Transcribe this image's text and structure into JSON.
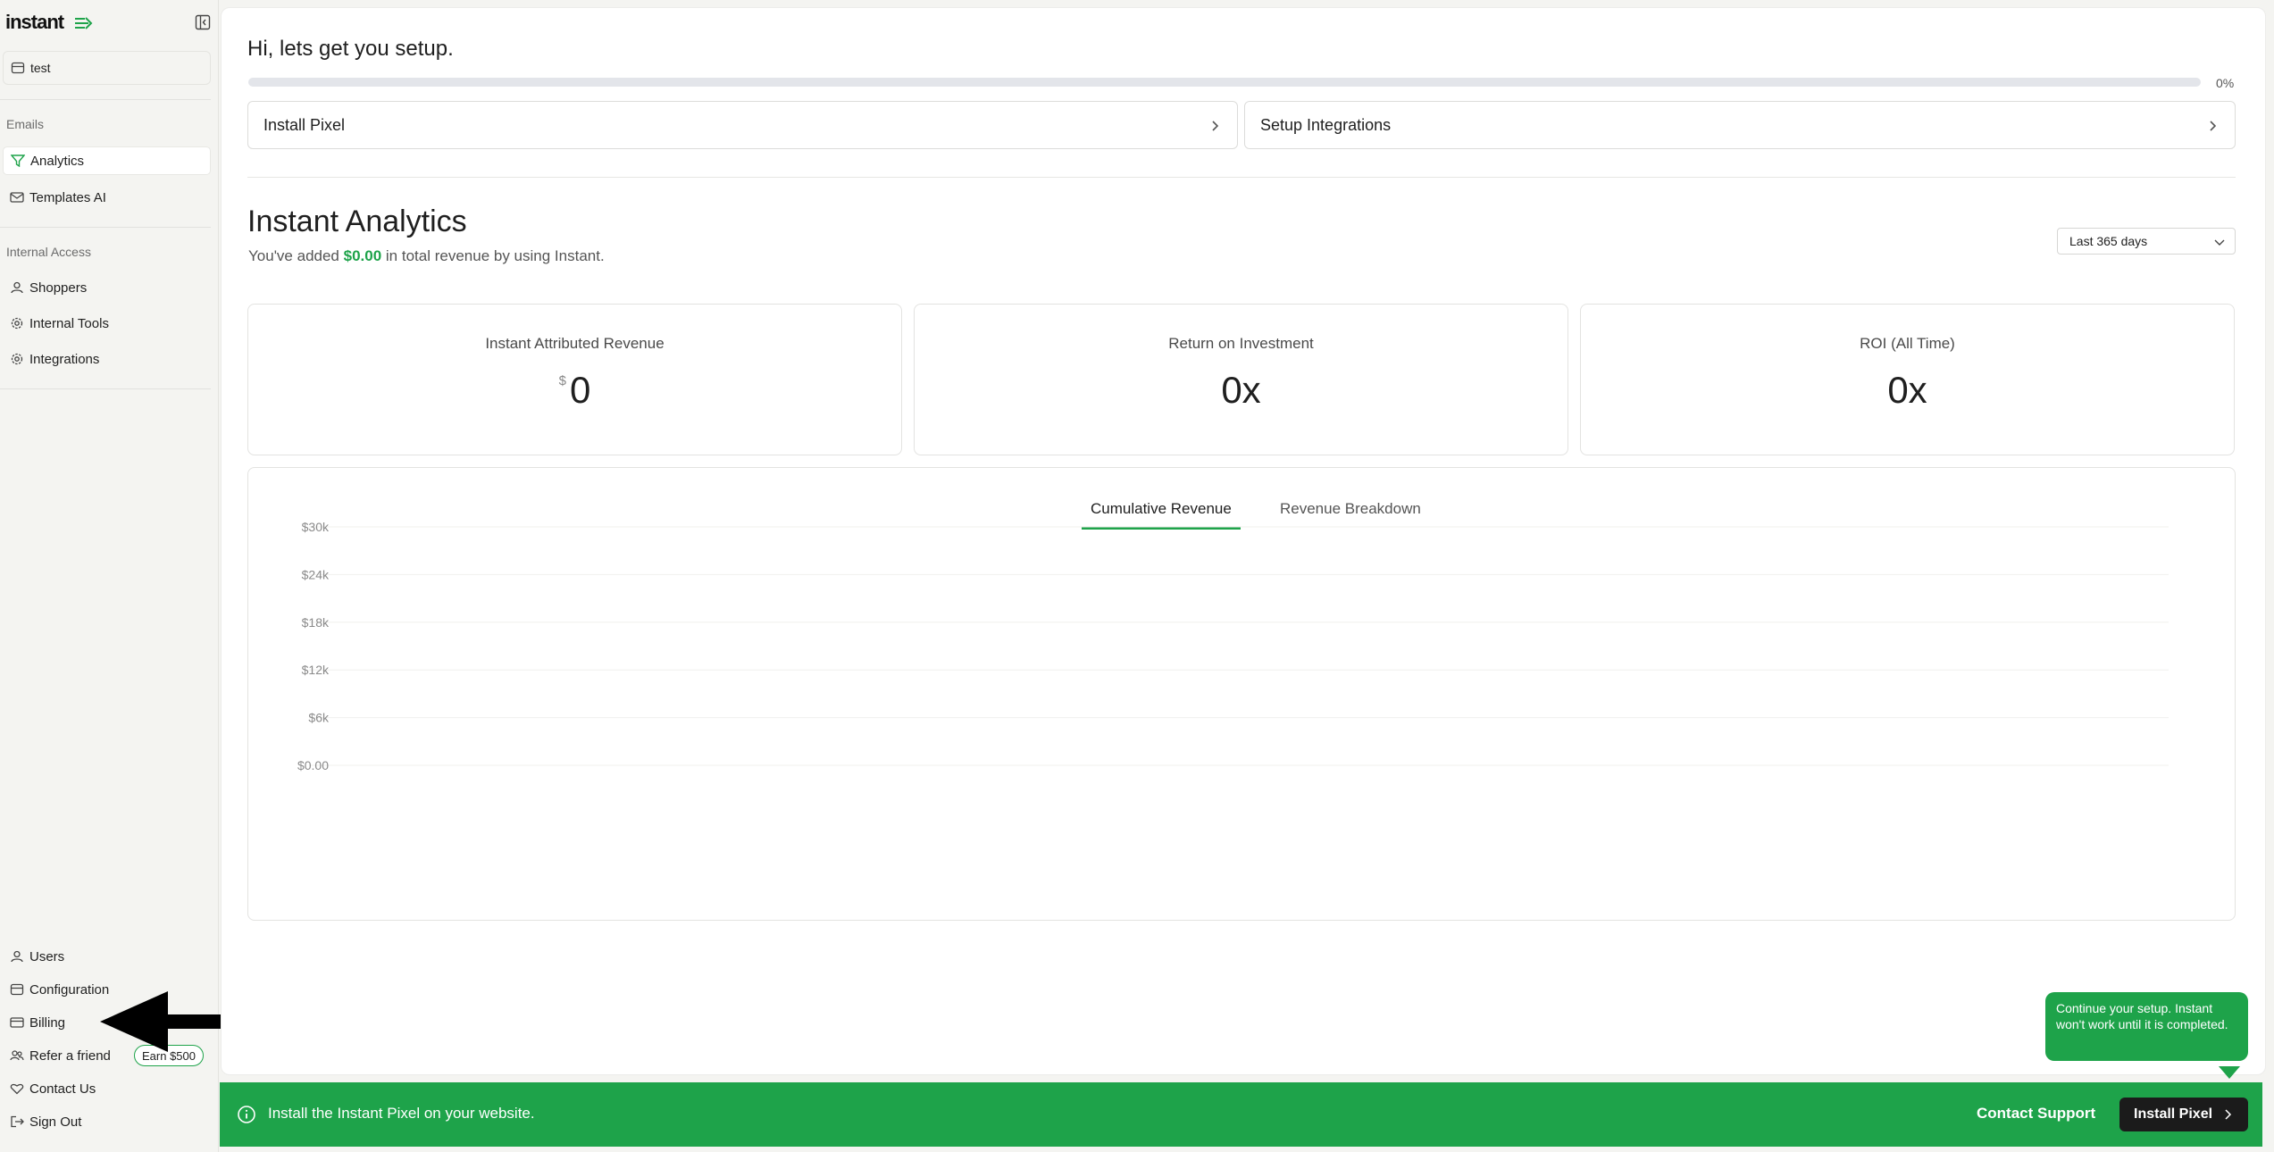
{
  "brand": {
    "logo": "instant",
    "logo_icon": "arrow-lines-icon",
    "accent": "#1ea34a"
  },
  "sidebar": {
    "store_name": "test",
    "sections": {
      "emails": "Emails",
      "internal": "Internal Access"
    },
    "emails_items": [
      {
        "label": "Analytics",
        "icon": "filter-icon",
        "active": true
      },
      {
        "label": "Templates AI",
        "icon": "mail-icon",
        "active": false
      }
    ],
    "internal_items": [
      {
        "label": "Shoppers",
        "icon": "user-icon"
      },
      {
        "label": "Internal Tools",
        "icon": "gear-icon"
      },
      {
        "label": "Integrations",
        "icon": "gear-icon"
      }
    ],
    "bottom_items": [
      {
        "label": "Users",
        "icon": "user-icon"
      },
      {
        "label": "Configuration",
        "icon": "store-icon"
      },
      {
        "label": "Billing",
        "icon": "card-icon"
      },
      {
        "label": "Refer a friend",
        "icon": "users-icon",
        "badge": "Earn $500"
      },
      {
        "label": "Contact Us",
        "icon": "heart-icon"
      },
      {
        "label": "Sign Out",
        "icon": "logout-icon"
      }
    ]
  },
  "setup": {
    "title": "Hi, lets get you setup.",
    "progress": 0,
    "progress_label": "0%",
    "steps": [
      "Install Pixel",
      "Setup Integrations"
    ]
  },
  "analytics": {
    "title": "Instant Analytics",
    "sub_prefix": "You've added",
    "sub_amount": "$0.00",
    "sub_suffix": "in total revenue by using Instant.",
    "range": "Last 365 days"
  },
  "metrics": [
    {
      "label": "Instant Attributed Revenue",
      "currency": "$",
      "value": "0"
    },
    {
      "label": "Return on Investment",
      "currency": "",
      "value": "0x"
    },
    {
      "label": "ROI (All Time)",
      "currency": "",
      "value": "0x"
    }
  ],
  "chart_tabs": {
    "active": "Cumulative Revenue",
    "inactive": "Revenue Breakdown"
  },
  "chart_data": {
    "type": "line",
    "title": "",
    "xlabel": "",
    "ylabel": "",
    "y_ticks": [
      "$30k",
      "$24k",
      "$18k",
      "$12k",
      "$6k",
      "$0.00"
    ],
    "ylim": [
      0,
      30000
    ],
    "grid": true,
    "series": []
  },
  "banner": {
    "message": "Install the Instant Pixel on your website.",
    "support": "Contact Support",
    "install": "Install Pixel"
  },
  "tooltip": {
    "text": "Continue your setup. Instant won't work until it is completed."
  }
}
